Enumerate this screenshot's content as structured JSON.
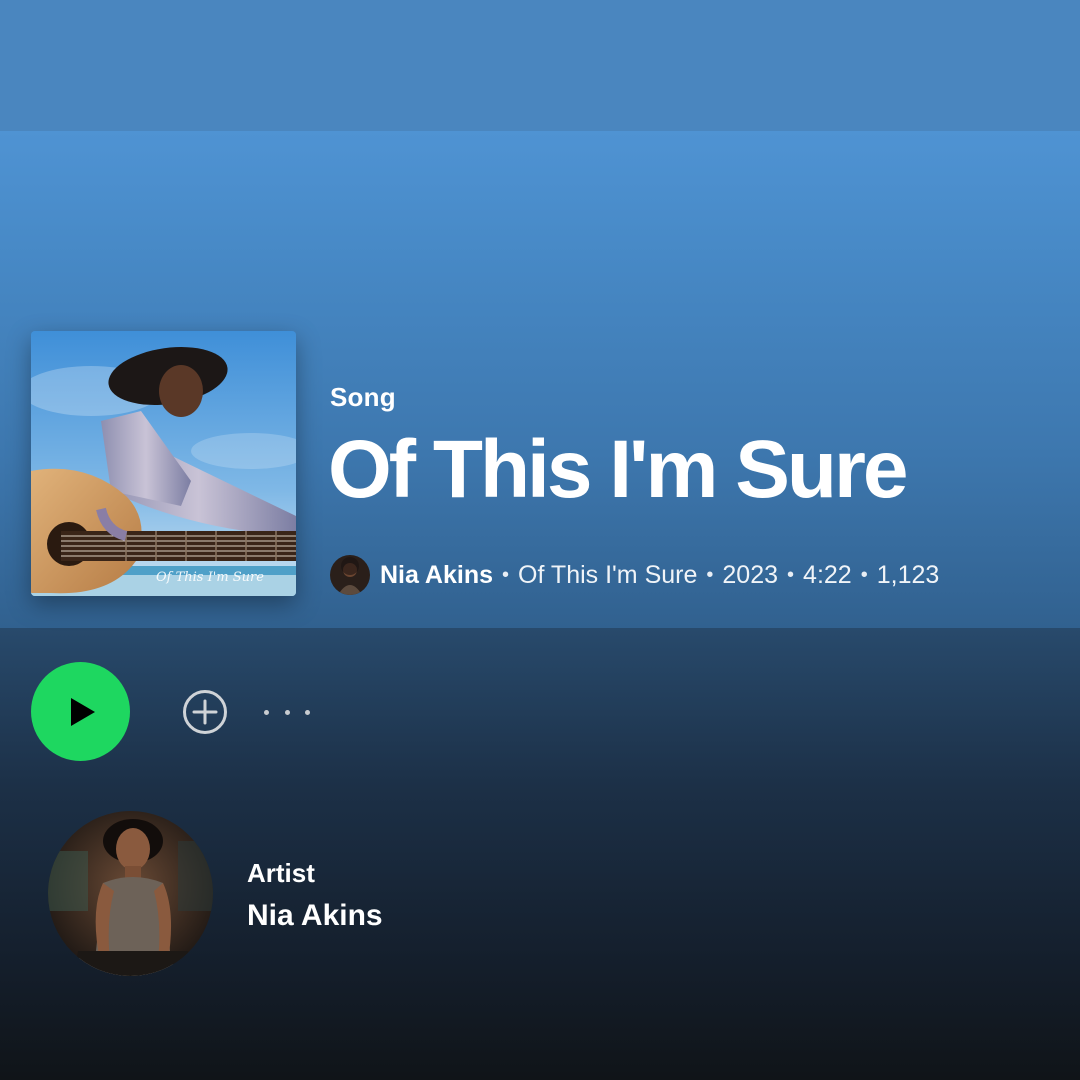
{
  "track": {
    "type_label": "Song",
    "title": "Of This I'm Sure",
    "artist": "Nia Akins",
    "album": "Of This I'm Sure",
    "year": "2023",
    "duration": "4:22",
    "play_count": "1,123",
    "separator": "•"
  },
  "cover": {
    "script_text": "Of This I'm Sure"
  },
  "actions": {
    "play_icon": "play-icon",
    "add_icon": "plus-circle-icon",
    "more_icon": "more-dots-icon"
  },
  "artist_section": {
    "label": "Artist",
    "name": "Nia Akins"
  },
  "colors": {
    "accent": "#1ed760",
    "header_top": "#4f93d3",
    "header_bottom": "#31618f",
    "background_bottom": "#101418"
  }
}
